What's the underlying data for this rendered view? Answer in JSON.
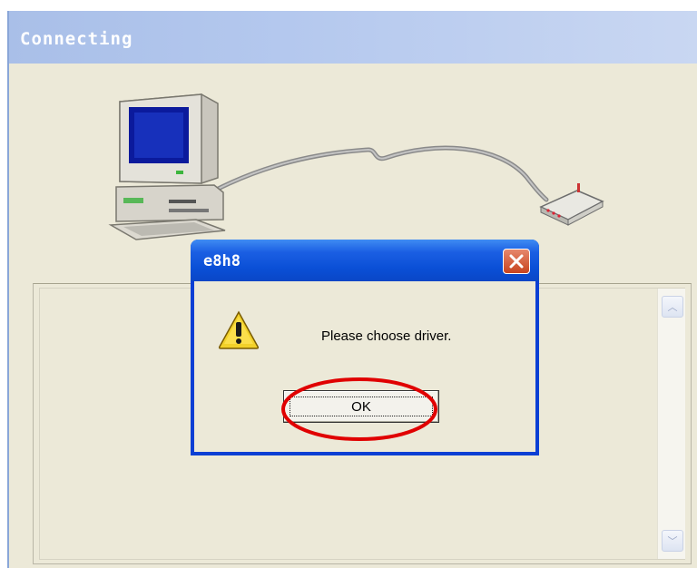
{
  "main_window": {
    "title": "Connecting"
  },
  "dialog": {
    "title": "e8h8",
    "message": "Please choose driver.",
    "ok_label": "OK",
    "close_glyph": "×"
  },
  "log_panel": {
    "scroll_up_glyph": "︿",
    "scroll_down_glyph": "﹀"
  },
  "icons": {
    "computer": "computer-icon",
    "modem": "modem-icon",
    "warning": "warning-icon",
    "close": "close-icon"
  },
  "colors": {
    "window_bg": "#ece9d8",
    "dialog_frame": "#0b3fd4",
    "close_red": "#c8441f",
    "highlight_red": "#e00000"
  }
}
